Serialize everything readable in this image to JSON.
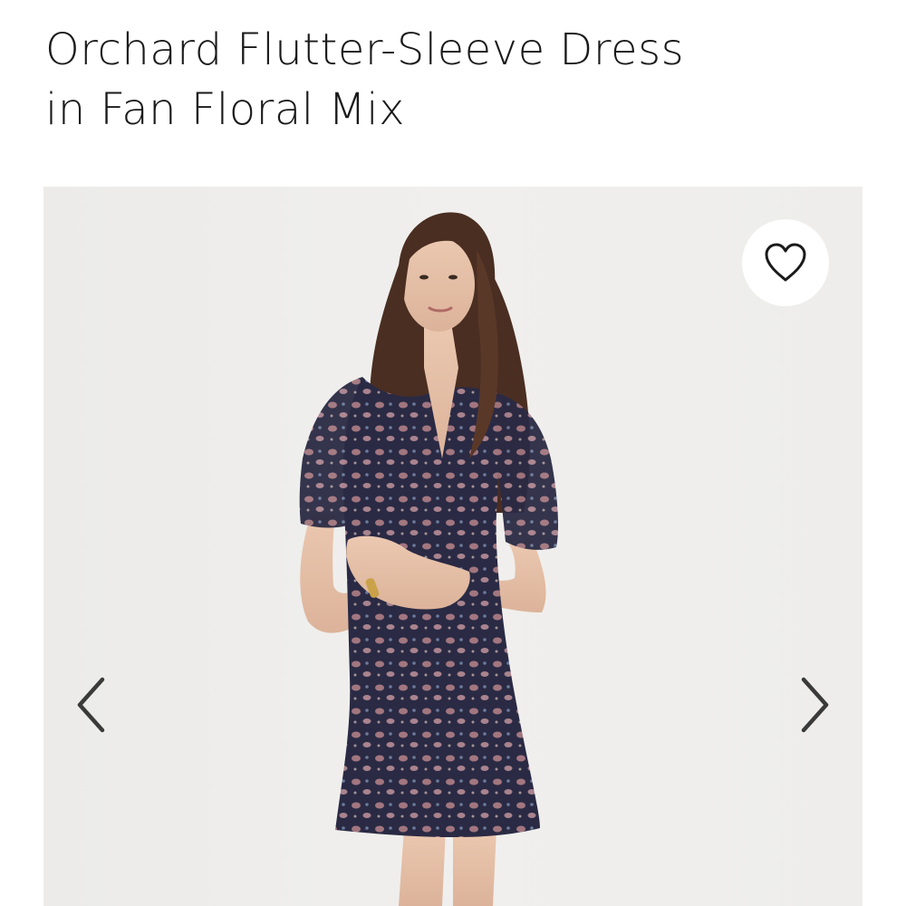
{
  "product": {
    "title_lines": [
      "Orchard Flutter-Sleeve Dress",
      "in Fan Floral Mix"
    ]
  },
  "gallery": {
    "favorite_icon": "heart-outline-icon",
    "prev_icon": "chevron-left-icon",
    "next_icon": "chevron-right-icon"
  },
  "colors": {
    "text": "#1a1a1a",
    "backdrop": "#eeedeb",
    "dress": "#2a2a44",
    "dress_print": "#b7848a",
    "hair": "#4a2e22",
    "skin": "#e4bfa6"
  }
}
